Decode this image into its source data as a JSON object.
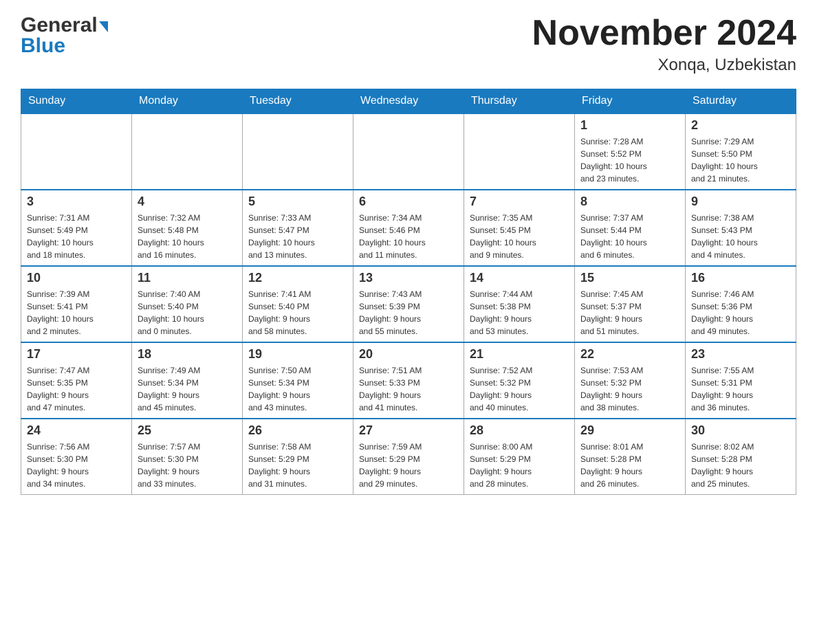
{
  "header": {
    "logo_general": "General",
    "logo_blue": "Blue",
    "month_title": "November 2024",
    "location": "Xonqa, Uzbekistan"
  },
  "weekdays": [
    "Sunday",
    "Monday",
    "Tuesday",
    "Wednesday",
    "Thursday",
    "Friday",
    "Saturday"
  ],
  "weeks": [
    [
      {
        "day": "",
        "info": ""
      },
      {
        "day": "",
        "info": ""
      },
      {
        "day": "",
        "info": ""
      },
      {
        "day": "",
        "info": ""
      },
      {
        "day": "",
        "info": ""
      },
      {
        "day": "1",
        "info": "Sunrise: 7:28 AM\nSunset: 5:52 PM\nDaylight: 10 hours\nand 23 minutes."
      },
      {
        "day": "2",
        "info": "Sunrise: 7:29 AM\nSunset: 5:50 PM\nDaylight: 10 hours\nand 21 minutes."
      }
    ],
    [
      {
        "day": "3",
        "info": "Sunrise: 7:31 AM\nSunset: 5:49 PM\nDaylight: 10 hours\nand 18 minutes."
      },
      {
        "day": "4",
        "info": "Sunrise: 7:32 AM\nSunset: 5:48 PM\nDaylight: 10 hours\nand 16 minutes."
      },
      {
        "day": "5",
        "info": "Sunrise: 7:33 AM\nSunset: 5:47 PM\nDaylight: 10 hours\nand 13 minutes."
      },
      {
        "day": "6",
        "info": "Sunrise: 7:34 AM\nSunset: 5:46 PM\nDaylight: 10 hours\nand 11 minutes."
      },
      {
        "day": "7",
        "info": "Sunrise: 7:35 AM\nSunset: 5:45 PM\nDaylight: 10 hours\nand 9 minutes."
      },
      {
        "day": "8",
        "info": "Sunrise: 7:37 AM\nSunset: 5:44 PM\nDaylight: 10 hours\nand 6 minutes."
      },
      {
        "day": "9",
        "info": "Sunrise: 7:38 AM\nSunset: 5:43 PM\nDaylight: 10 hours\nand 4 minutes."
      }
    ],
    [
      {
        "day": "10",
        "info": "Sunrise: 7:39 AM\nSunset: 5:41 PM\nDaylight: 10 hours\nand 2 minutes."
      },
      {
        "day": "11",
        "info": "Sunrise: 7:40 AM\nSunset: 5:40 PM\nDaylight: 10 hours\nand 0 minutes."
      },
      {
        "day": "12",
        "info": "Sunrise: 7:41 AM\nSunset: 5:40 PM\nDaylight: 9 hours\nand 58 minutes."
      },
      {
        "day": "13",
        "info": "Sunrise: 7:43 AM\nSunset: 5:39 PM\nDaylight: 9 hours\nand 55 minutes."
      },
      {
        "day": "14",
        "info": "Sunrise: 7:44 AM\nSunset: 5:38 PM\nDaylight: 9 hours\nand 53 minutes."
      },
      {
        "day": "15",
        "info": "Sunrise: 7:45 AM\nSunset: 5:37 PM\nDaylight: 9 hours\nand 51 minutes."
      },
      {
        "day": "16",
        "info": "Sunrise: 7:46 AM\nSunset: 5:36 PM\nDaylight: 9 hours\nand 49 minutes."
      }
    ],
    [
      {
        "day": "17",
        "info": "Sunrise: 7:47 AM\nSunset: 5:35 PM\nDaylight: 9 hours\nand 47 minutes."
      },
      {
        "day": "18",
        "info": "Sunrise: 7:49 AM\nSunset: 5:34 PM\nDaylight: 9 hours\nand 45 minutes."
      },
      {
        "day": "19",
        "info": "Sunrise: 7:50 AM\nSunset: 5:34 PM\nDaylight: 9 hours\nand 43 minutes."
      },
      {
        "day": "20",
        "info": "Sunrise: 7:51 AM\nSunset: 5:33 PM\nDaylight: 9 hours\nand 41 minutes."
      },
      {
        "day": "21",
        "info": "Sunrise: 7:52 AM\nSunset: 5:32 PM\nDaylight: 9 hours\nand 40 minutes."
      },
      {
        "day": "22",
        "info": "Sunrise: 7:53 AM\nSunset: 5:32 PM\nDaylight: 9 hours\nand 38 minutes."
      },
      {
        "day": "23",
        "info": "Sunrise: 7:55 AM\nSunset: 5:31 PM\nDaylight: 9 hours\nand 36 minutes."
      }
    ],
    [
      {
        "day": "24",
        "info": "Sunrise: 7:56 AM\nSunset: 5:30 PM\nDaylight: 9 hours\nand 34 minutes."
      },
      {
        "day": "25",
        "info": "Sunrise: 7:57 AM\nSunset: 5:30 PM\nDaylight: 9 hours\nand 33 minutes."
      },
      {
        "day": "26",
        "info": "Sunrise: 7:58 AM\nSunset: 5:29 PM\nDaylight: 9 hours\nand 31 minutes."
      },
      {
        "day": "27",
        "info": "Sunrise: 7:59 AM\nSunset: 5:29 PM\nDaylight: 9 hours\nand 29 minutes."
      },
      {
        "day": "28",
        "info": "Sunrise: 8:00 AM\nSunset: 5:29 PM\nDaylight: 9 hours\nand 28 minutes."
      },
      {
        "day": "29",
        "info": "Sunrise: 8:01 AM\nSunset: 5:28 PM\nDaylight: 9 hours\nand 26 minutes."
      },
      {
        "day": "30",
        "info": "Sunrise: 8:02 AM\nSunset: 5:28 PM\nDaylight: 9 hours\nand 25 minutes."
      }
    ]
  ]
}
